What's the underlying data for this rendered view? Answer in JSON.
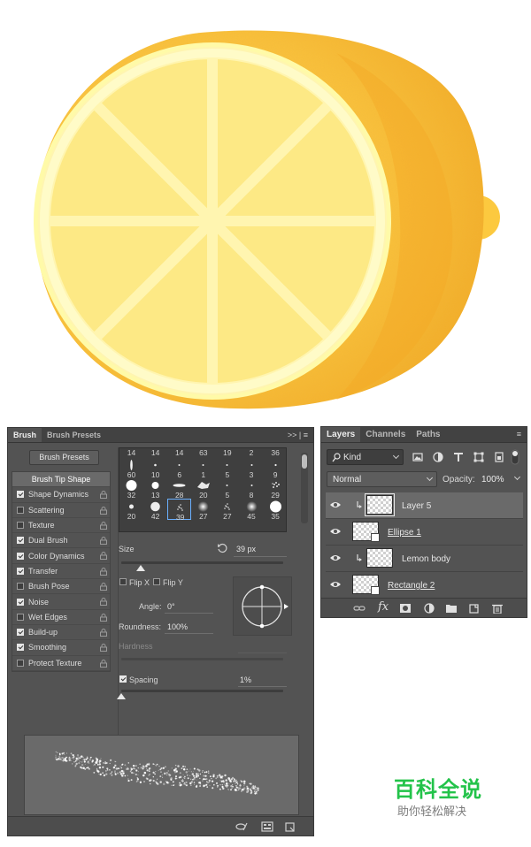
{
  "brush_panel": {
    "tabs": [
      "Brush",
      "Brush Presets"
    ],
    "tab_menu": ">> | ≡",
    "presets_button": "Brush Presets",
    "options": [
      {
        "label": "Brush Tip Shape",
        "selected": true,
        "checkbox": false
      },
      {
        "label": "Shape Dynamics",
        "checked": true
      },
      {
        "label": "Scattering",
        "checked": false
      },
      {
        "label": "Texture",
        "checked": false
      },
      {
        "label": "Dual Brush",
        "checked": true
      },
      {
        "label": "Color Dynamics",
        "checked": true
      },
      {
        "label": "Transfer",
        "checked": true
      },
      {
        "label": "Brush Pose",
        "checked": false
      },
      {
        "label": "Noise",
        "checked": true
      },
      {
        "label": "Wet Edges",
        "checked": false
      },
      {
        "label": "Build-up",
        "checked": true
      },
      {
        "label": "Smoothing",
        "checked": true
      },
      {
        "label": "Protect Texture",
        "checked": false
      }
    ],
    "tip_sizes": [
      [
        "14",
        "14",
        "14",
        "63",
        "19",
        "2",
        "36"
      ],
      [
        "60",
        "10",
        "6",
        "1",
        "5",
        "3",
        "9"
      ],
      [
        "32",
        "13",
        "28",
        "20",
        "5",
        "8",
        "29"
      ],
      [
        "20",
        "42",
        "39",
        "27",
        "27",
        "45",
        "35"
      ]
    ],
    "selected_tip": "39",
    "size_label": "Size",
    "size_value": "39 px",
    "size_fraction": 0.12,
    "flip_x_label": "Flip X",
    "flip_y_label": "Flip Y",
    "angle_label": "Angle:",
    "angle_value": "0°",
    "roundness_label": "Roundness:",
    "roundness_value": "100%",
    "hardness_label": "Hardness",
    "spacing_label": "Spacing",
    "spacing_value": "1%",
    "spacing_checked": true,
    "spacing_fraction": 0.0
  },
  "layers_panel": {
    "tabs": [
      "Layers",
      "Channels",
      "Paths"
    ],
    "filter_kind": "Kind",
    "blend_mode": "Normal",
    "opacity_label": "Opacity:",
    "opacity_value": "100%",
    "layers": [
      {
        "name": "Layer 5",
        "selected": true,
        "clipped": true,
        "shape": false
      },
      {
        "name": "Ellipse 1",
        "selected": false,
        "clipped": false,
        "shape": true
      },
      {
        "name": "Lemon body",
        "selected": false,
        "clipped": true,
        "shape": false
      },
      {
        "name": "Rectangle 2",
        "selected": false,
        "clipped": false,
        "shape": true
      }
    ]
  },
  "watermark": {
    "title": "百科全说",
    "subtitle": "助你轻松解决"
  },
  "colors": {
    "panel_bg": "#535353",
    "lemon_rind": "#f5b82a",
    "lemon_flesh": "#fde57e",
    "lemon_pith": "#fff8b8",
    "watermark_green": "#23c34a"
  }
}
